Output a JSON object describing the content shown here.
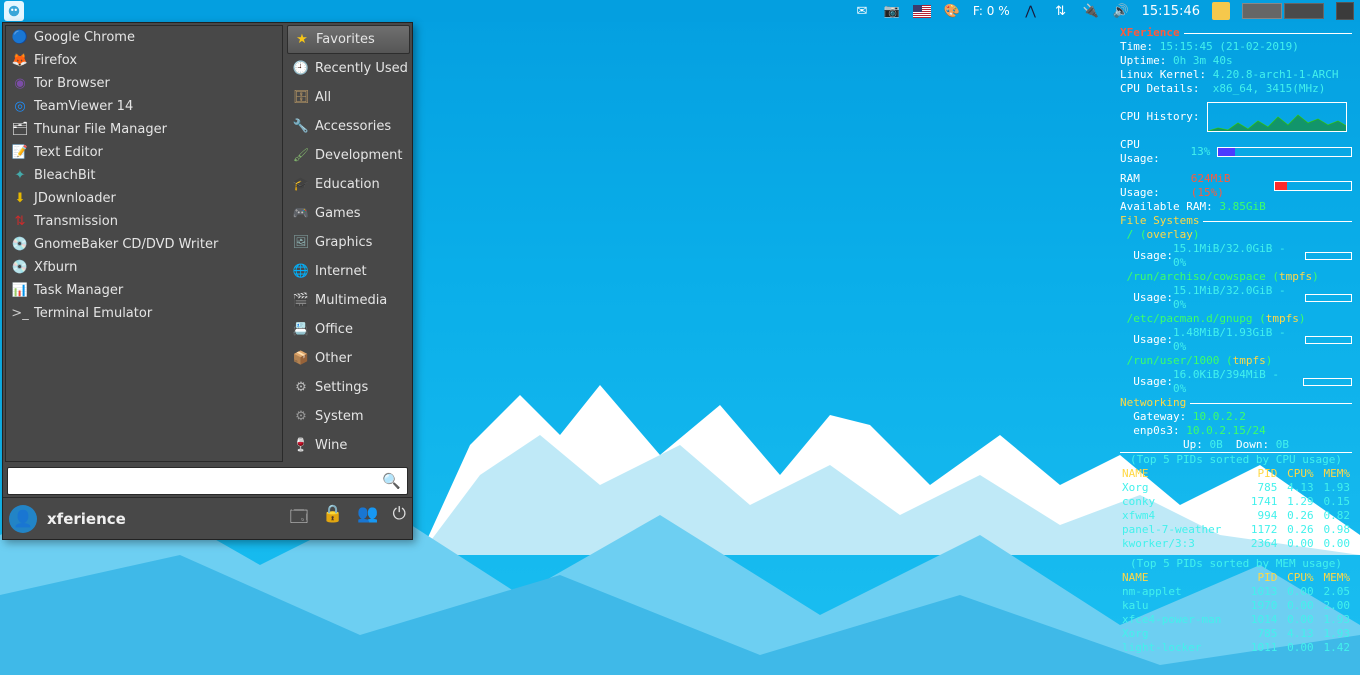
{
  "panel": {
    "temp_label": "F: 0 %",
    "clock": "15:15:46"
  },
  "menu": {
    "apps": [
      {
        "icon": "🔵",
        "iconColor": "",
        "name": "google-chrome",
        "label": "Google Chrome"
      },
      {
        "icon": "🦊",
        "iconColor": "",
        "name": "firefox",
        "label": "Firefox"
      },
      {
        "icon": "◉",
        "iconColor": "#7b4da6",
        "name": "tor-browser",
        "label": "Tor Browser"
      },
      {
        "icon": "◎",
        "iconColor": "#1e90ff",
        "name": "teamviewer",
        "label": "TeamViewer 14"
      },
      {
        "icon": "🗂",
        "iconColor": "",
        "name": "thunar",
        "label": "Thunar File Manager"
      },
      {
        "icon": "📝",
        "iconColor": "",
        "name": "text-editor",
        "label": "Text Editor"
      },
      {
        "icon": "✦",
        "iconColor": "#4aa",
        "name": "bleachbit",
        "label": "BleachBit"
      },
      {
        "icon": "⬇",
        "iconColor": "#e6b800",
        "name": "jdownloader",
        "label": "JDownloader"
      },
      {
        "icon": "⇅",
        "iconColor": "#cc2b2b",
        "name": "transmission",
        "label": "Transmission"
      },
      {
        "icon": "💿",
        "iconColor": "",
        "name": "gnomebaker",
        "label": "GnomeBaker CD/DVD Writer"
      },
      {
        "icon": "💿",
        "iconColor": "",
        "name": "xfburn",
        "label": "Xfburn"
      },
      {
        "icon": "📊",
        "iconColor": "",
        "name": "task-manager",
        "label": "Task Manager"
      },
      {
        "icon": ">_",
        "iconColor": "#ccc",
        "name": "terminal",
        "label": "Terminal Emulator"
      }
    ],
    "cats": [
      {
        "icon": "★",
        "iconColor": "#f5c518",
        "name": "favorites",
        "label": "Favorites",
        "selected": true
      },
      {
        "icon": "🕘",
        "iconColor": "#bbb",
        "name": "recent",
        "label": "Recently Used"
      },
      {
        "icon": "🗄",
        "iconColor": "#c9a36a",
        "name": "all",
        "label": "All"
      },
      {
        "icon": "🔧",
        "iconColor": "#cc4444",
        "name": "accessories",
        "label": "Accessories"
      },
      {
        "icon": "🖌",
        "iconColor": "#7fb06b",
        "name": "development",
        "label": "Development"
      },
      {
        "icon": "🎓",
        "iconColor": "#b88",
        "name": "education",
        "label": "Education"
      },
      {
        "icon": "🎮",
        "iconColor": "#bbb",
        "name": "games",
        "label": "Games"
      },
      {
        "icon": "🖼",
        "iconColor": "#8aa",
        "name": "graphics",
        "label": "Graphics"
      },
      {
        "icon": "🌐",
        "iconColor": "#4aa0dd",
        "name": "internet",
        "label": "Internet"
      },
      {
        "icon": "🎬",
        "iconColor": "#999",
        "name": "multimedia",
        "label": "Multimedia"
      },
      {
        "icon": "📇",
        "iconColor": "#c9a36a",
        "name": "office",
        "label": "Office"
      },
      {
        "icon": "📦",
        "iconColor": "#c9a36a",
        "name": "other",
        "label": "Other"
      },
      {
        "icon": "⚙",
        "iconColor": "#bbb",
        "name": "settings",
        "label": "Settings"
      },
      {
        "icon": "⚙",
        "iconColor": "#999",
        "name": "system",
        "label": "System"
      },
      {
        "icon": "🍷",
        "iconColor": "",
        "name": "wine",
        "label": "Wine"
      }
    ],
    "search_placeholder": "",
    "user": "xferience"
  },
  "conky": {
    "title": "XFerience",
    "time_label": "Time:",
    "time": "15:15:45 (21-02-2019)",
    "uptime_label": "Uptime:",
    "uptime": "0h 3m 40s",
    "kernel_label": "Linux Kernel:",
    "kernel": "4.20.8-arch1-1-ARCH",
    "cpu_details_label": "CPU Details:",
    "cpu_details": "x86_64, 3415(MHz)",
    "cpu_history_label": "CPU History:",
    "cpu_usage_label": "CPU Usage:",
    "cpu_usage_val": "13%",
    "cpu_usage_pct": 13,
    "ram_usage_label": "RAM Usage:",
    "ram_usage_val": "624MiB (15%)",
    "ram_usage_pct": 15,
    "avail_ram_label": "Available RAM:",
    "avail_ram": "3.85GiB",
    "fs_label": "File Systems",
    "fs": [
      {
        "mount": "/ (overlay)",
        "usage": "15.1MiB/32.0GiB - 0%",
        "pct": 0
      },
      {
        "mount": "/run/archiso/cowspace (tmpfs)",
        "usage": "15.1MiB/32.0GiB - 0%",
        "pct": 0
      },
      {
        "mount": "/etc/pacman.d/gnupg (tmpfs)",
        "usage": "1.48MiB/1.93GiB - 0%",
        "pct": 0
      },
      {
        "mount": "/run/user/1000 (tmpfs)",
        "usage": "16.0KiB/394MiB - 0%",
        "pct": 0
      }
    ],
    "net_label": "Networking",
    "gateway_label": "Gateway:",
    "gateway": "10.0.2.2",
    "iface_label": "enp0s3:",
    "iface": "10.0.2.15/24",
    "up_label": "Up:",
    "up": "0B",
    "down_label": "Down:",
    "down": "0B",
    "top_cpu_label": "(Top 5 PIDs sorted by CPU usage)",
    "top_mem_label": "(Top 5 PIDs sorted by MEM usage)",
    "header_name": "NAME",
    "header_pid": "PID",
    "header_cpu": "CPU%",
    "header_mem": "MEM%",
    "top_cpu": [
      {
        "name": "Xorg",
        "pid": "785",
        "cpu": "4.13",
        "mem": "1.93"
      },
      {
        "name": "conky",
        "pid": "1741",
        "cpu": "1.29",
        "mem": "0.15"
      },
      {
        "name": "xfwm4",
        "pid": "994",
        "cpu": "0.26",
        "mem": "0.82"
      },
      {
        "name": "panel-7-weather",
        "pid": "1172",
        "cpu": "0.26",
        "mem": "0.98"
      },
      {
        "name": "kworker/3:3",
        "pid": "2364",
        "cpu": "0.00",
        "mem": "0.00"
      }
    ],
    "top_mem": [
      {
        "name": "nm-applet",
        "pid": "1013",
        "cpu": "0.00",
        "mem": "2.05"
      },
      {
        "name": "kalu",
        "pid": "1970",
        "cpu": "0.00",
        "mem": "2.00"
      },
      {
        "name": "xfce4-power-man",
        "pid": "1014",
        "cpu": "0.00",
        "mem": "1.93"
      },
      {
        "name": "Xorg",
        "pid": "785",
        "cpu": "4.13",
        "mem": "1.93"
      },
      {
        "name": "light-locker",
        "pid": "1011",
        "cpu": "0.00",
        "mem": "1.42"
      }
    ]
  }
}
